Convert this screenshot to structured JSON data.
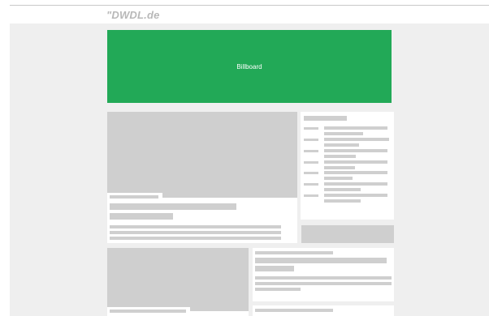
{
  "header": {
    "logo": "\"DWDL.de"
  },
  "billboard": {
    "label": "Billboard"
  },
  "colors": {
    "billboard_bg": "#22a957",
    "page_bg": "#efefef",
    "placeholder": "#cfcfcf",
    "card_bg": "#ffffff",
    "logo": "#b8b8b8"
  }
}
